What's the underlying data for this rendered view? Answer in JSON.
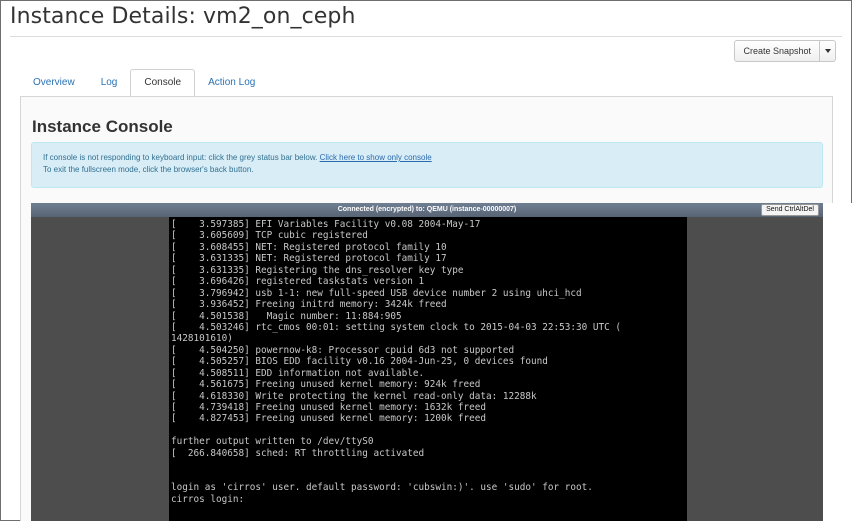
{
  "page": {
    "title": "Instance Details: vm2_on_ceph"
  },
  "actions": {
    "create_snapshot_label": "Create Snapshot",
    "more_actions_icon": "caret-down-icon"
  },
  "tabs": [
    {
      "label": "Overview",
      "active": false
    },
    {
      "label": "Log",
      "active": false
    },
    {
      "label": "Console",
      "active": true
    },
    {
      "label": "Action Log",
      "active": false
    }
  ],
  "console": {
    "heading": "Instance Console",
    "info_line1_text": "If console is not responding to keyboard input: click the grey status bar below.",
    "info_line1_link": "Click here to show only console",
    "info_line2": "To exit the fullscreen mode, click the browser's back button.",
    "status": "Connected (encrypted) to: QEMU (instance-00000007)",
    "send_ctrl_alt_del": "Send CtrlAltDel",
    "terminal_lines": [
      "[    3.597385] EFI Variables Facility v0.08 2004-May-17",
      "[    3.605609] TCP cubic registered",
      "[    3.608455] NET: Registered protocol family 10",
      "[    3.631335] NET: Registered protocol family 17",
      "[    3.631335] Registering the dns_resolver key type",
      "[    3.696426] registered taskstats version 1",
      "[    3.796942] usb 1-1: new full-speed USB device number 2 using uhci_hcd",
      "[    3.936452] Freeing initrd memory: 3424k freed",
      "[    4.501538]   Magic number: 11:884:905",
      "[    4.503246] rtc_cmos 00:01: setting system clock to 2015-04-03 22:53:30 UTC (",
      "1428101610)",
      "[    4.504250] powernow-k8: Processor cpuid 6d3 not supported",
      "[    4.505257] BIOS EDD facility v0.16 2004-Jun-25, 0 devices found",
      "[    4.508511] EDD information not available.",
      "[    4.561675] Freeing unused kernel memory: 924k freed",
      "[    4.618330] Write protecting the kernel read-only data: 12288k",
      "[    4.739418] Freeing unused kernel memory: 1632k freed",
      "[    4.827453] Freeing unused kernel memory: 1200k freed",
      "",
      "further output written to /dev/ttyS0",
      "[  266.840658] sched: RT throttling activated",
      "",
      "",
      "login as 'cirros' user. default password: 'cubswin:)'. use 'sudo' for root.",
      "cirros login:"
    ]
  },
  "colors": {
    "link": "#2a72b5",
    "info_bg": "#d9edf7",
    "status_bar": "#6f7e90",
    "terminal_bg": "#000000",
    "terminal_fg": "#c8c8c8"
  }
}
